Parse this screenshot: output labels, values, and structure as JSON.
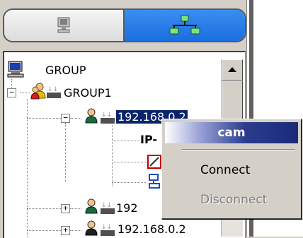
{
  "tabs": [
    {
      "icon": "computer-icon"
    },
    {
      "icon": "network-icon",
      "active": true
    }
  ],
  "tree": {
    "root": "GROUP",
    "group1": "GROUP1",
    "device_selected": "192.168.0.2",
    "child_label": "IP-",
    "device_2": "192",
    "device_3": "192.168.0.2"
  },
  "context_menu": {
    "title": "cam",
    "items": [
      {
        "label": "Connect",
        "enabled": true
      },
      {
        "label": "Disconnect",
        "enabled": false
      }
    ]
  },
  "colors": {
    "selection": "#0a246a",
    "active_tab": "#1c6ee0",
    "menu_header": "#1a2a78"
  }
}
